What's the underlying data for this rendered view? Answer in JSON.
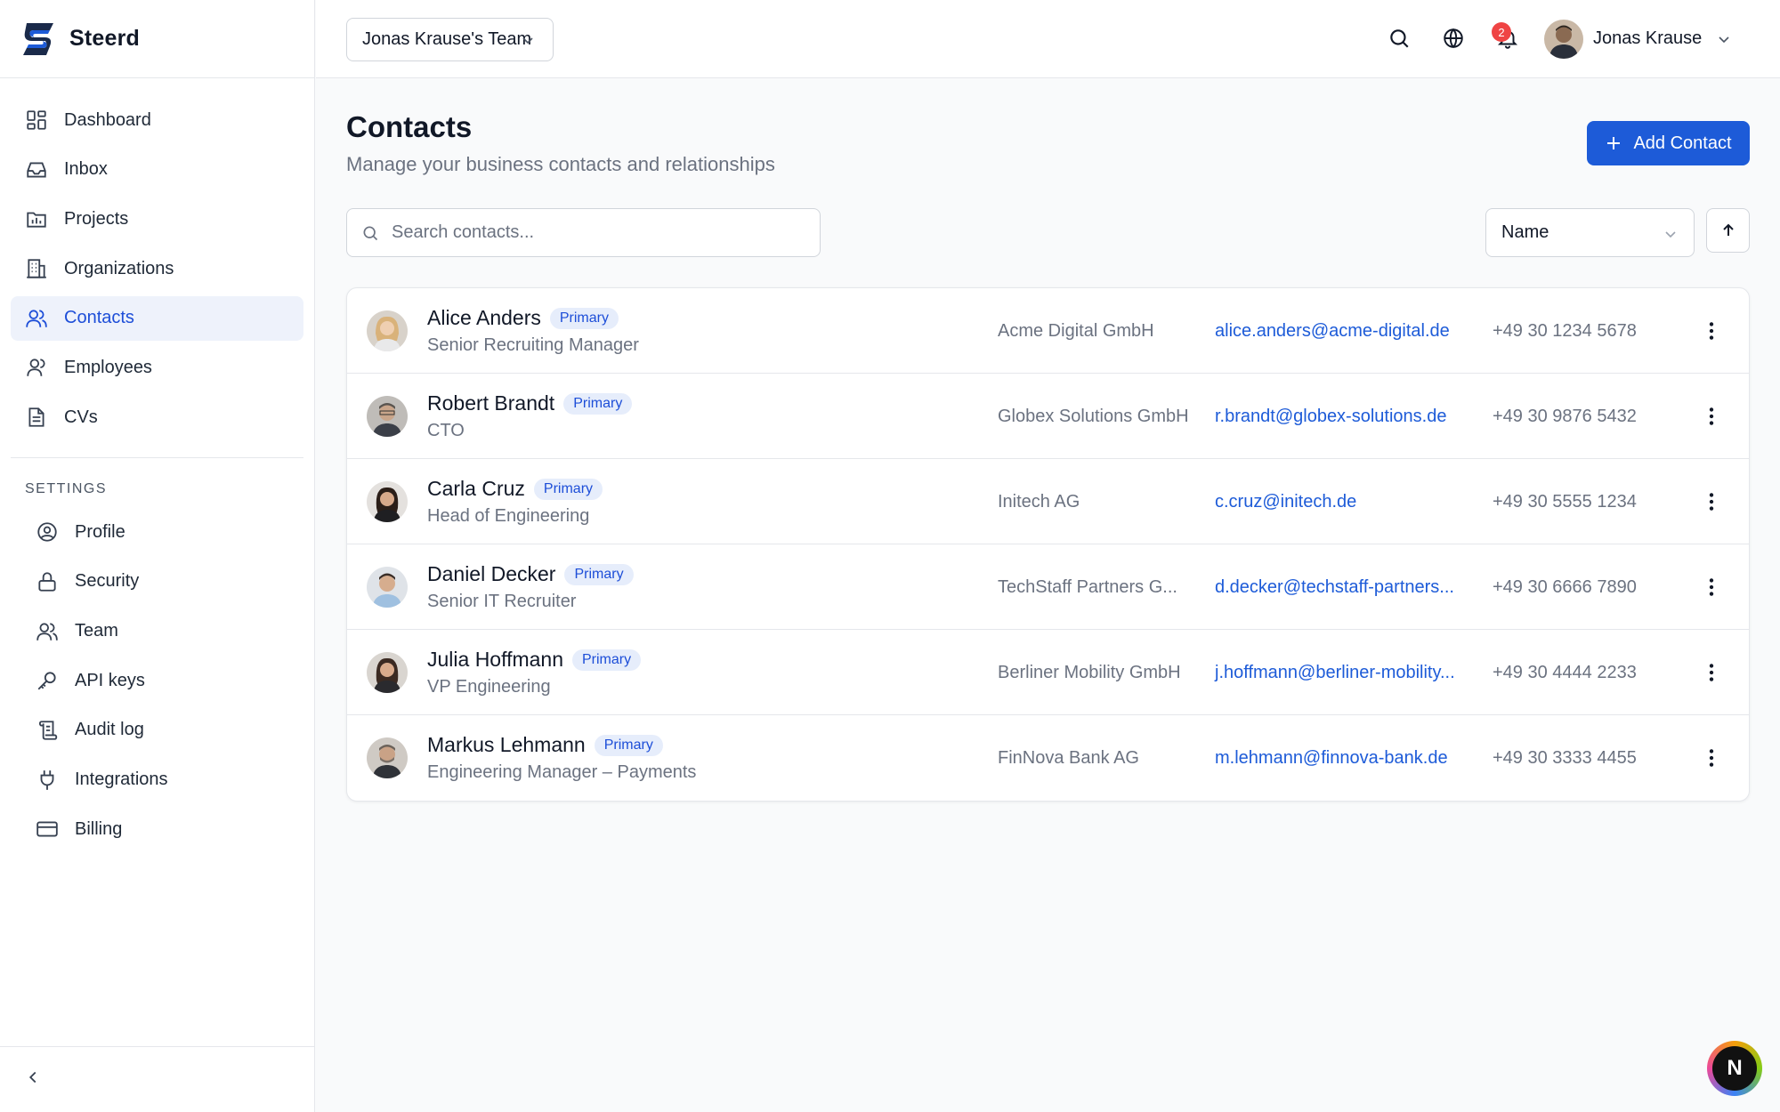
{
  "brand": {
    "name": "Steerd",
    "accent": "#1d5bd8"
  },
  "sidebar": {
    "items": [
      {
        "label": "Dashboard",
        "icon": "dashboard-icon",
        "active": false
      },
      {
        "label": "Inbox",
        "icon": "inbox-icon",
        "active": false
      },
      {
        "label": "Projects",
        "icon": "projects-icon",
        "active": false
      },
      {
        "label": "Organizations",
        "icon": "building-icon",
        "active": false
      },
      {
        "label": "Contacts",
        "icon": "users-icon",
        "active": true
      },
      {
        "label": "Employees",
        "icon": "user-icon",
        "active": false
      },
      {
        "label": "CVs",
        "icon": "document-icon",
        "active": false
      }
    ],
    "settings_title": "SETTINGS",
    "settings": [
      {
        "label": "Profile",
        "icon": "user-circle-icon"
      },
      {
        "label": "Security",
        "icon": "lock-icon"
      },
      {
        "label": "Team",
        "icon": "team-icon"
      },
      {
        "label": "API keys",
        "icon": "key-icon"
      },
      {
        "label": "Audit log",
        "icon": "scroll-icon"
      },
      {
        "label": "Integrations",
        "icon": "plug-icon"
      },
      {
        "label": "Billing",
        "icon": "credit-card-icon"
      }
    ]
  },
  "header": {
    "team": "Jonas Krause's Team",
    "notifications_count": "2",
    "user_name": "Jonas Krause"
  },
  "main": {
    "title": "Contacts",
    "subtitle": "Manage your business contacts and relationships",
    "add_label": "Add Contact",
    "search_placeholder": "Search contacts...",
    "sort_value": "Name",
    "contacts": [
      {
        "name": "Alice Anders",
        "badge": "Primary",
        "role": "Senior Recruiting Manager",
        "org": "Acme Digital GmbH",
        "email": "alice.anders@acme-digital.de",
        "phone": "+49 30 1234 5678"
      },
      {
        "name": "Robert Brandt",
        "badge": "Primary",
        "role": "CTO",
        "org": "Globex Solutions GmbH",
        "email": "r.brandt@globex-solutions.de",
        "phone": "+49 30 9876 5432"
      },
      {
        "name": "Carla Cruz",
        "badge": "Primary",
        "role": "Head of Engineering",
        "org": "Initech AG",
        "email": "c.cruz@initech.de",
        "phone": "+49 30 5555 1234"
      },
      {
        "name": "Daniel Decker",
        "badge": "Primary",
        "role": "Senior IT Recruiter",
        "org": "TechStaff Partners G...",
        "email": "d.decker@techstaff-partners...",
        "phone": "+49 30 6666 7890"
      },
      {
        "name": "Julia Hoffmann",
        "badge": "Primary",
        "role": "VP Engineering",
        "org": "Berliner Mobility GmbH",
        "email": "j.hoffmann@berliner-mobility...",
        "phone": "+49 30 4444 2233"
      },
      {
        "name": "Markus Lehmann",
        "badge": "Primary",
        "role": "Engineering Manager – Payments",
        "org": "FinNova Bank AG",
        "email": "m.lehmann@finnova-bank.de",
        "phone": "+49 30 3333 4455"
      }
    ]
  },
  "dev_badge": "N"
}
